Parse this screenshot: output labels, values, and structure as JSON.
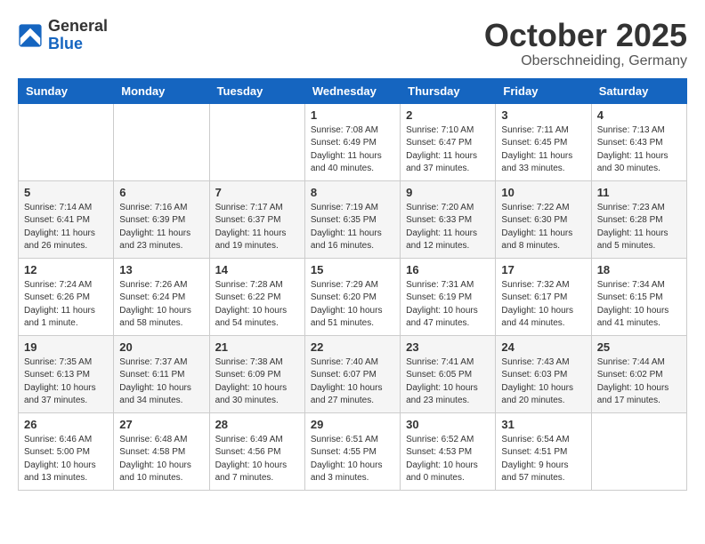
{
  "header": {
    "logo": {
      "general": "General",
      "blue": "Blue"
    },
    "title": "October 2025",
    "location": "Oberschneiding, Germany"
  },
  "weekdays": [
    "Sunday",
    "Monday",
    "Tuesday",
    "Wednesday",
    "Thursday",
    "Friday",
    "Saturday"
  ],
  "weeks": [
    [
      {
        "day": "",
        "info": ""
      },
      {
        "day": "",
        "info": ""
      },
      {
        "day": "",
        "info": ""
      },
      {
        "day": "1",
        "info": "Sunrise: 7:08 AM\nSunset: 6:49 PM\nDaylight: 11 hours\nand 40 minutes."
      },
      {
        "day": "2",
        "info": "Sunrise: 7:10 AM\nSunset: 6:47 PM\nDaylight: 11 hours\nand 37 minutes."
      },
      {
        "day": "3",
        "info": "Sunrise: 7:11 AM\nSunset: 6:45 PM\nDaylight: 11 hours\nand 33 minutes."
      },
      {
        "day": "4",
        "info": "Sunrise: 7:13 AM\nSunset: 6:43 PM\nDaylight: 11 hours\nand 30 minutes."
      }
    ],
    [
      {
        "day": "5",
        "info": "Sunrise: 7:14 AM\nSunset: 6:41 PM\nDaylight: 11 hours\nand 26 minutes."
      },
      {
        "day": "6",
        "info": "Sunrise: 7:16 AM\nSunset: 6:39 PM\nDaylight: 11 hours\nand 23 minutes."
      },
      {
        "day": "7",
        "info": "Sunrise: 7:17 AM\nSunset: 6:37 PM\nDaylight: 11 hours\nand 19 minutes."
      },
      {
        "day": "8",
        "info": "Sunrise: 7:19 AM\nSunset: 6:35 PM\nDaylight: 11 hours\nand 16 minutes."
      },
      {
        "day": "9",
        "info": "Sunrise: 7:20 AM\nSunset: 6:33 PM\nDaylight: 11 hours\nand 12 minutes."
      },
      {
        "day": "10",
        "info": "Sunrise: 7:22 AM\nSunset: 6:30 PM\nDaylight: 11 hours\nand 8 minutes."
      },
      {
        "day": "11",
        "info": "Sunrise: 7:23 AM\nSunset: 6:28 PM\nDaylight: 11 hours\nand 5 minutes."
      }
    ],
    [
      {
        "day": "12",
        "info": "Sunrise: 7:24 AM\nSunset: 6:26 PM\nDaylight: 11 hours\nand 1 minute."
      },
      {
        "day": "13",
        "info": "Sunrise: 7:26 AM\nSunset: 6:24 PM\nDaylight: 10 hours\nand 58 minutes."
      },
      {
        "day": "14",
        "info": "Sunrise: 7:28 AM\nSunset: 6:22 PM\nDaylight: 10 hours\nand 54 minutes."
      },
      {
        "day": "15",
        "info": "Sunrise: 7:29 AM\nSunset: 6:20 PM\nDaylight: 10 hours\nand 51 minutes."
      },
      {
        "day": "16",
        "info": "Sunrise: 7:31 AM\nSunset: 6:19 PM\nDaylight: 10 hours\nand 47 minutes."
      },
      {
        "day": "17",
        "info": "Sunrise: 7:32 AM\nSunset: 6:17 PM\nDaylight: 10 hours\nand 44 minutes."
      },
      {
        "day": "18",
        "info": "Sunrise: 7:34 AM\nSunset: 6:15 PM\nDaylight: 10 hours\nand 41 minutes."
      }
    ],
    [
      {
        "day": "19",
        "info": "Sunrise: 7:35 AM\nSunset: 6:13 PM\nDaylight: 10 hours\nand 37 minutes."
      },
      {
        "day": "20",
        "info": "Sunrise: 7:37 AM\nSunset: 6:11 PM\nDaylight: 10 hours\nand 34 minutes."
      },
      {
        "day": "21",
        "info": "Sunrise: 7:38 AM\nSunset: 6:09 PM\nDaylight: 10 hours\nand 30 minutes."
      },
      {
        "day": "22",
        "info": "Sunrise: 7:40 AM\nSunset: 6:07 PM\nDaylight: 10 hours\nand 27 minutes."
      },
      {
        "day": "23",
        "info": "Sunrise: 7:41 AM\nSunset: 6:05 PM\nDaylight: 10 hours\nand 23 minutes."
      },
      {
        "day": "24",
        "info": "Sunrise: 7:43 AM\nSunset: 6:03 PM\nDaylight: 10 hours\nand 20 minutes."
      },
      {
        "day": "25",
        "info": "Sunrise: 7:44 AM\nSunset: 6:02 PM\nDaylight: 10 hours\nand 17 minutes."
      }
    ],
    [
      {
        "day": "26",
        "info": "Sunrise: 6:46 AM\nSunset: 5:00 PM\nDaylight: 10 hours\nand 13 minutes."
      },
      {
        "day": "27",
        "info": "Sunrise: 6:48 AM\nSunset: 4:58 PM\nDaylight: 10 hours\nand 10 minutes."
      },
      {
        "day": "28",
        "info": "Sunrise: 6:49 AM\nSunset: 4:56 PM\nDaylight: 10 hours\nand 7 minutes."
      },
      {
        "day": "29",
        "info": "Sunrise: 6:51 AM\nSunset: 4:55 PM\nDaylight: 10 hours\nand 3 minutes."
      },
      {
        "day": "30",
        "info": "Sunrise: 6:52 AM\nSunset: 4:53 PM\nDaylight: 10 hours\nand 0 minutes."
      },
      {
        "day": "31",
        "info": "Sunrise: 6:54 AM\nSunset: 4:51 PM\nDaylight: 9 hours\nand 57 minutes."
      },
      {
        "day": "",
        "info": ""
      }
    ]
  ]
}
